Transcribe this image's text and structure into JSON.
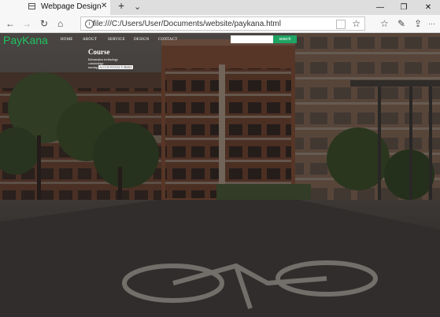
{
  "browser": {
    "tab_title": "Webpage Design",
    "tab_close": "✕",
    "new_tab": "+",
    "tab_menu": "⌄",
    "window_minimize": "—",
    "window_restore": "❐",
    "window_close": "✕",
    "nav_back": "←",
    "nav_forward": "→",
    "nav_refresh": "↻",
    "nav_home": "⌂",
    "address_info": "i",
    "address": "file:///C:/Users/User/Documents/website/paykana.html",
    "favorite": "☆",
    "favorites_hub": "☆",
    "pen": "✎",
    "share": "⇪",
    "more": "···"
  },
  "site": {
    "logo": "PayKana",
    "menu": [
      "HOME",
      "ABOUT",
      "SERVICE",
      "DESIGN",
      "CONTACT"
    ],
    "search_button": "search",
    "course": {
      "title": "Course",
      "line1": "Information technology",
      "line2": "criminology",
      "line3_label": "nursing",
      "line3_badge": "ACCOUNTANCY/BSBA"
    }
  },
  "colors": {
    "logo": "#1ec55f",
    "search_button": "#1fa463"
  }
}
